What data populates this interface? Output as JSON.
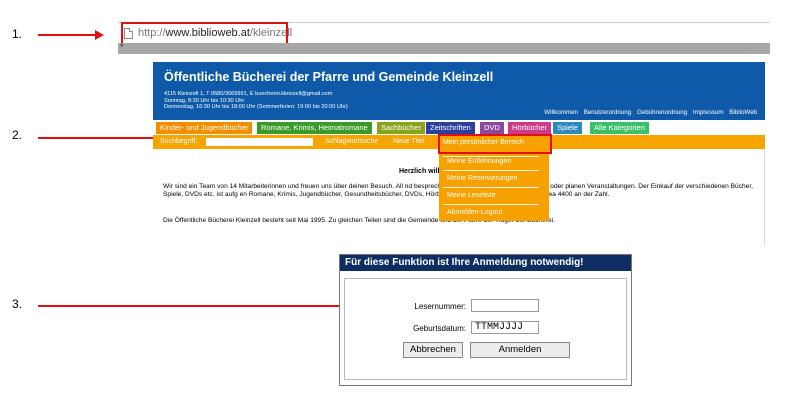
{
  "steps": [
    "1.",
    "2.",
    "3."
  ],
  "colors": {
    "header": "#0f5aa8",
    "orange": "#f6a100",
    "highlight": "#e01010",
    "dialog_title": "#0e2e63"
  },
  "browser": {
    "url_prefix": "http://",
    "url_domain": "www.biblioweb.at",
    "url_path": "/kleinzell"
  },
  "site": {
    "title": "Öffentliche Bücherei der Pfarre und Gemeinde Kleinzell",
    "address": [
      "4115 Kleinzell 1, T 0680/3069991, E buecherei.kleinzell@gmail.com",
      "Sonntag, 8:30 Uhr bis 10:30 Uhr",
      "Donnerstag, 16:30 Uhr bis 18:00 Uhr (Sommerferien: 19:00 bis 20:00 Uhr)"
    ],
    "toplinks": [
      "Willkommen",
      "Benutzerordnung",
      "Gebührenordnung",
      "Impressum",
      "BiblioWeb"
    ],
    "categories": [
      "Kinder- und Jugendbücher",
      "Romane, Krimis, Heimatromane",
      "Sachbücher",
      "Zeitschriften",
      "DVD",
      "Hörbücher",
      "Spiele",
      "Alle Kategorien"
    ],
    "search": {
      "label": "Suchbegriff:",
      "advanced": "Schlagwortsuche",
      "new_titles": "Neue Titel"
    },
    "welcome": "Herzlich willkom",
    "body_1": "Wir sind ein Team von 14 Mitarbeiterinnen und freuen uns über deinen Besuch. All                                                              nd besprechen, was anfällt bzw. sortieren Bücher oder planen Veranstaltungen. Der Einkauf der verschiedenen Bücher, Spiele, DVDs etc. ist aufg                                                             en Romane, Krimis, Jugendbücher, Gesundheitsbücher, DVDs, Hörbücher und Spiele entlehnt werden, etwa 4400 an der Zahl.",
    "body_2": "Die Öffentliche Bücherei Kleinzell besteht seit Mai 1995. Zu gleichen Teilen sind die Gemeinde und die Pfarre der Träger der Bücherei.",
    "dropdown": [
      "Mein persönlicher Bereich",
      "Meine Entlehnungen",
      "Meine Reservierungen",
      "Meine Leseliste",
      "Abmelden-Logout"
    ]
  },
  "login": {
    "title": "Für diese Funktion ist Ihre Anmeldung notwendig!",
    "reader_label": "Lesernummer:",
    "reader_value": "",
    "birth_label": "Geburtsdatum:",
    "birth_value": "TTMMJJJJ",
    "cancel": "Abbrechen",
    "login": "Anmelden"
  }
}
